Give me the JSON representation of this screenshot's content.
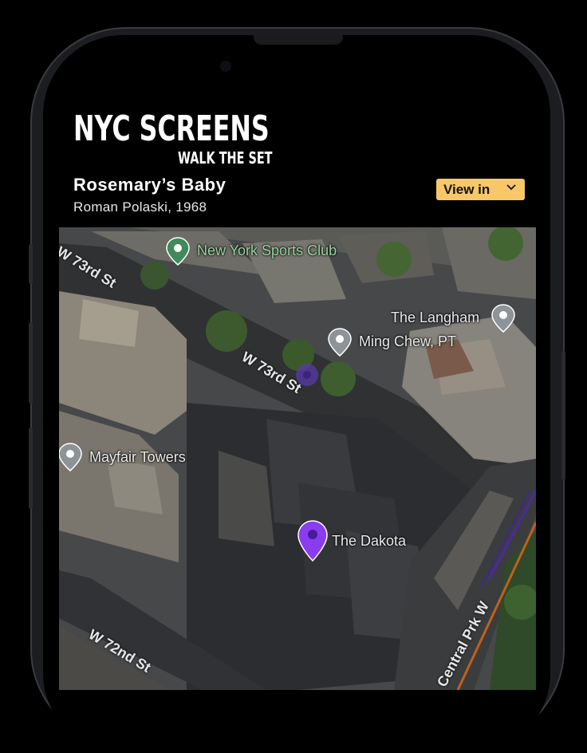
{
  "brand": {
    "title": "NYC SCREENS",
    "subtitle": "WALK THE SET"
  },
  "film": {
    "title": "Rosemary’s Baby",
    "meta": "Roman Polaski, 1968"
  },
  "view_button": {
    "label": "View in",
    "color": "#f7c768"
  },
  "map": {
    "places": {
      "ny_sports_club": "New York Sports Club",
      "langham": "The Langham",
      "ming_chew": "Ming Chew, PT",
      "mayfair": "Mayfair Towers",
      "dakota": "The Dakota"
    },
    "streets": {
      "w73_top": "W 73rd St",
      "w73_mid": "W 73rd St",
      "w72": "W 72nd St",
      "cpw": "Central Prk W"
    },
    "pin_colors": {
      "selected": "#8a3cf0",
      "green": "#3f8a5a",
      "gray": "#8d9396"
    }
  }
}
